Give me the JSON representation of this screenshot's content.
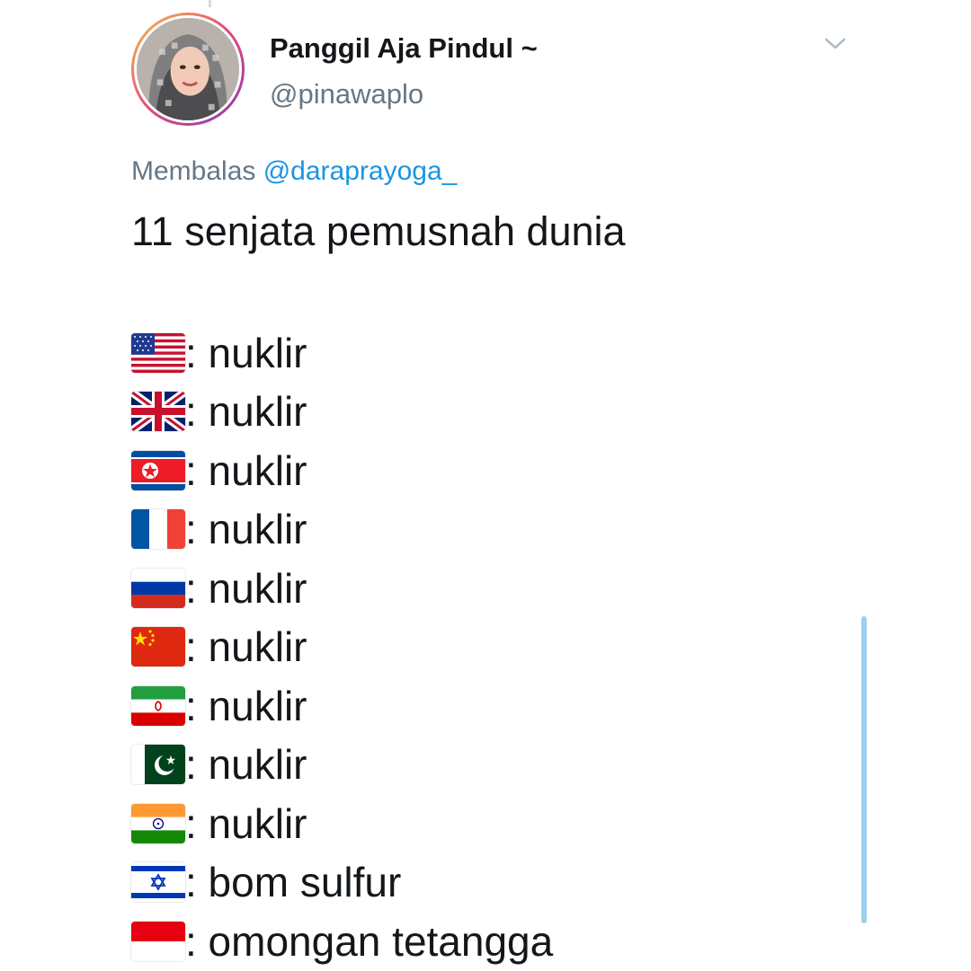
{
  "tweet": {
    "display_name": "Panggil Aja Pindul ~",
    "handle": "@pinawaplo",
    "reply_prefix": "Membalas ",
    "reply_to": "@daraprayoga_",
    "text": "11 senjata pemusnah dunia",
    "menu_icon": "chevron-down-icon"
  },
  "flag_rows": [
    {
      "flag": "flag-usa-icon",
      "text": ": nuklir"
    },
    {
      "flag": "flag-uk-icon",
      "text": ": nuklir"
    },
    {
      "flag": "flag-north-korea-icon",
      "text": ": nuklir"
    },
    {
      "flag": "flag-france-icon",
      "text": ": nuklir"
    },
    {
      "flag": "flag-russia-icon",
      "text": ": nuklir"
    },
    {
      "flag": "flag-china-icon",
      "text": ": nuklir"
    },
    {
      "flag": "flag-iran-icon",
      "text": ": nuklir"
    },
    {
      "flag": "flag-pakistan-icon",
      "text": ": nuklir"
    },
    {
      "flag": "flag-india-icon",
      "text": ": nuklir"
    },
    {
      "flag": "flag-israel-icon",
      "text": ": bom sulfur"
    },
    {
      "flag": "flag-indonesia-icon",
      "text": ": omongan tetangga"
    }
  ],
  "colors": {
    "text": "#14171a",
    "secondary": "#657786",
    "link": "#1b95e0",
    "scrollbar": "#9ed0ee"
  }
}
